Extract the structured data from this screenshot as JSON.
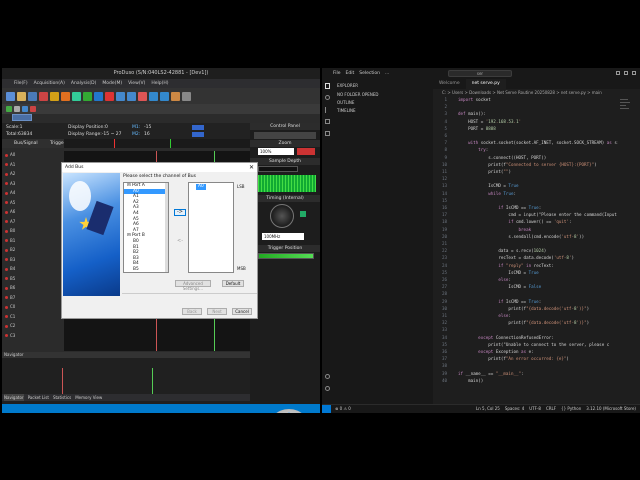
{
  "left_app": {
    "title": "ProDuso (S/N:040LS2-42881 - [Dev1])",
    "menu": [
      "File(F)",
      "Acquisition(A)",
      "Analysis(D)",
      "Mode(M)",
      "View(V)",
      "Help(H)"
    ],
    "info": {
      "scale": "Scale:1",
      "total": "Total:63834",
      "display_position": "Display Position:0",
      "display_range": "Display Range:-15 ~ 27",
      "m1": "M1:",
      "m1v": "-15",
      "m2": "M2:",
      "m2v": "16"
    },
    "columns": [
      "Bus/Signal",
      "Trigger"
    ],
    "rows": [
      "A0",
      "A1",
      "A2",
      "A3",
      "A4",
      "A5",
      "A6",
      "A7",
      "B0",
      "B1",
      "B2",
      "B3",
      "B4",
      "B5",
      "B6",
      "B7",
      "C0",
      "C1",
      "C2",
      "C3"
    ],
    "nav_label": "Navigator",
    "tabs": [
      "Navigator",
      "Packet List",
      "Statistics",
      "Memory View"
    ],
    "control_panel": {
      "title": "Control Panel",
      "zoom": "Zoom",
      "zoom_value": "100%",
      "sample_depth": "Sample Depth",
      "timing": "Timing (Internal)",
      "trigger_position": "Trigger Position",
      "rate": "100MHz"
    }
  },
  "dialog": {
    "title": "Add Bus",
    "prompt": "Please select the channel of Bus",
    "port_a": "Port A",
    "port_b": "Port B",
    "port_a_items": [
      "A0",
      "A1",
      "A2",
      "A3",
      "A4",
      "A5",
      "A6",
      "A7"
    ],
    "port_b_items": [
      "B0",
      "B1",
      "B2",
      "B3",
      "B4",
      "B5",
      "B6"
    ],
    "selected_right": "A0",
    "lsb": "LSB",
    "msb": "MSB",
    "add": "->",
    "remove": "<-",
    "advanced": "Advanced Settings...",
    "default": "Default",
    "back": "Back",
    "next": "Next",
    "cancel": "Cancel"
  },
  "vscode": {
    "menu": [
      "File",
      "Edit",
      "Selection",
      "..."
    ],
    "search": "ser",
    "side_items": [
      "EXPLORER",
      "NO FOLDER OPENED",
      "OUTLINE",
      "TIMELINE"
    ],
    "tabs": [
      "Welcome",
      "net serve.py"
    ],
    "breadcrumb": "C: > Users > Downloads > Net Serve Routine 20250828 > net serve.py > main",
    "code": [
      {
        "n": "1",
        "t": "import socket"
      },
      {
        "n": "2",
        "t": ""
      },
      {
        "n": "3",
        "t": "def main():"
      },
      {
        "n": "4",
        "t": "    HOST = '192.168.53.1'"
      },
      {
        "n": "5",
        "t": "    PORT = 8888"
      },
      {
        "n": "6",
        "t": ""
      },
      {
        "n": "7",
        "t": "    with socket.socket(socket.AF_INET, socket.SOCK_STREAM) as s:"
      },
      {
        "n": "8",
        "t": "        try:"
      },
      {
        "n": "9",
        "t": "            s.connect((HOST, PORT))"
      },
      {
        "n": "10",
        "t": "            print(f\"Connected to server {HOST}:{PORT}\")"
      },
      {
        "n": "11",
        "t": "            print(\"\")"
      },
      {
        "n": "12",
        "t": ""
      },
      {
        "n": "13",
        "t": "            IsCMD = True"
      },
      {
        "n": "14",
        "t": "            while True:"
      },
      {
        "n": "15",
        "t": ""
      },
      {
        "n": "16",
        "t": "                if IsCMD == True:"
      },
      {
        "n": "17",
        "t": "                    cmd = input(\"Please enter the command(Input"
      },
      {
        "n": "18",
        "t": "                    if cmd.lower() == 'quit':"
      },
      {
        "n": "19",
        "t": "                        break"
      },
      {
        "n": "20",
        "t": "                    s.sendall(cmd.encode('utf-8'))"
      },
      {
        "n": "21",
        "t": ""
      },
      {
        "n": "22",
        "t": "                data = s.recv(1024)"
      },
      {
        "n": "23",
        "t": "                recText = data.decode('utf-8')"
      },
      {
        "n": "24",
        "t": "                if \"reply\" in recText:"
      },
      {
        "n": "25",
        "t": "                    IsCMD = True"
      },
      {
        "n": "26",
        "t": "                else:"
      },
      {
        "n": "27",
        "t": "                    IsCMD = False"
      },
      {
        "n": "28",
        "t": ""
      },
      {
        "n": "29",
        "t": "                if IsCMD == True:"
      },
      {
        "n": "30",
        "t": "                    print(f\"{data.decode('utf-8')}\")"
      },
      {
        "n": "31",
        "t": "                else:"
      },
      {
        "n": "32",
        "t": "                    print(f\"{data.decode('utf-8')}\")"
      },
      {
        "n": "33",
        "t": ""
      },
      {
        "n": "34",
        "t": "        except ConnectionRefusedError:"
      },
      {
        "n": "35",
        "t": "            print(\"Unable to connect to the server, please c"
      },
      {
        "n": "36",
        "t": "        except Exception as e:"
      },
      {
        "n": "37",
        "t": "            print(f\"An error occurred: {e}\")"
      },
      {
        "n": "38",
        "t": ""
      },
      {
        "n": "39",
        "t": "if __name__ == \"__main__\":"
      },
      {
        "n": "40",
        "t": "    main()"
      }
    ],
    "status_left": "⊗ 0 ⚠ 0",
    "status_right": [
      "Ln 5, Col 25",
      "Spaces: 4",
      "UTF-8",
      "CRLF",
      "{} Python",
      "3.12.10 (Microsoft Store)"
    ]
  }
}
